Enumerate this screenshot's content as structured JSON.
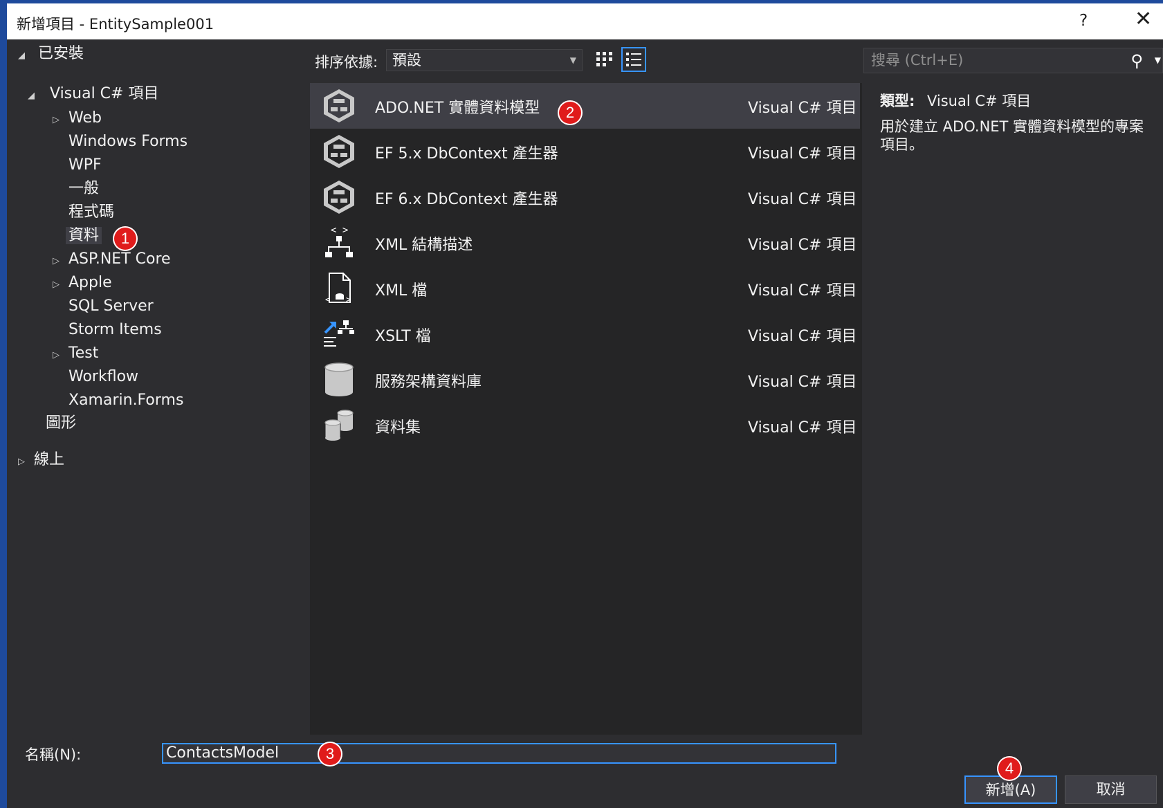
{
  "window": {
    "title": "新增項目 - EntitySample001",
    "help": "?",
    "close": "✕"
  },
  "tree": {
    "installed": "已安裝",
    "visual_csharp": "Visual C# 項目",
    "items": [
      "Web",
      "Windows Forms",
      "WPF",
      "一般",
      "程式碼",
      "資料",
      "ASP.NET Core",
      "Apple",
      "SQL Server",
      "Storm Items",
      "Test",
      "Workflow",
      "Xamarin.Forms"
    ],
    "graphics": "圖形",
    "online": "線上"
  },
  "toolbar": {
    "sort_label": "排序依據:",
    "sort_value": "預設",
    "search_placeholder": "搜尋 (Ctrl+E)"
  },
  "templates": [
    {
      "name": "ADO.NET 實體資料模型",
      "type": "Visual C# 項目",
      "icon": "entity-model-icon"
    },
    {
      "name": "EF 5.x DbContext 產生器",
      "type": "Visual C# 項目",
      "icon": "entity-model-icon"
    },
    {
      "name": "EF 6.x DbContext 產生器",
      "type": "Visual C# 項目",
      "icon": "entity-model-icon"
    },
    {
      "name": "XML 結構描述",
      "type": "Visual C# 項目",
      "icon": "xml-schema-icon"
    },
    {
      "name": "XML 檔",
      "type": "Visual C# 項目",
      "icon": "xml-file-icon"
    },
    {
      "name": "XSLT 檔",
      "type": "Visual C# 項目",
      "icon": "xslt-file-icon"
    },
    {
      "name": "服務架構資料庫",
      "type": "Visual C# 項目",
      "icon": "database-icon"
    },
    {
      "name": "資料集",
      "type": "Visual C# 項目",
      "icon": "dataset-icon"
    }
  ],
  "details": {
    "type_label": "類型:",
    "type_value": "Visual C# 項目",
    "description": "用於建立 ADO.NET 實體資料模型的專案項目。"
  },
  "bottom": {
    "name_label": "名稱(N):",
    "name_value": "ContactsModel",
    "add_label": "新增(A)",
    "cancel_label": "取消"
  },
  "badges": [
    "1",
    "2",
    "3",
    "4"
  ],
  "colors": {
    "accent": "#3794ff",
    "badge": "#e01b1b",
    "window_border": "#1e4a9c"
  }
}
